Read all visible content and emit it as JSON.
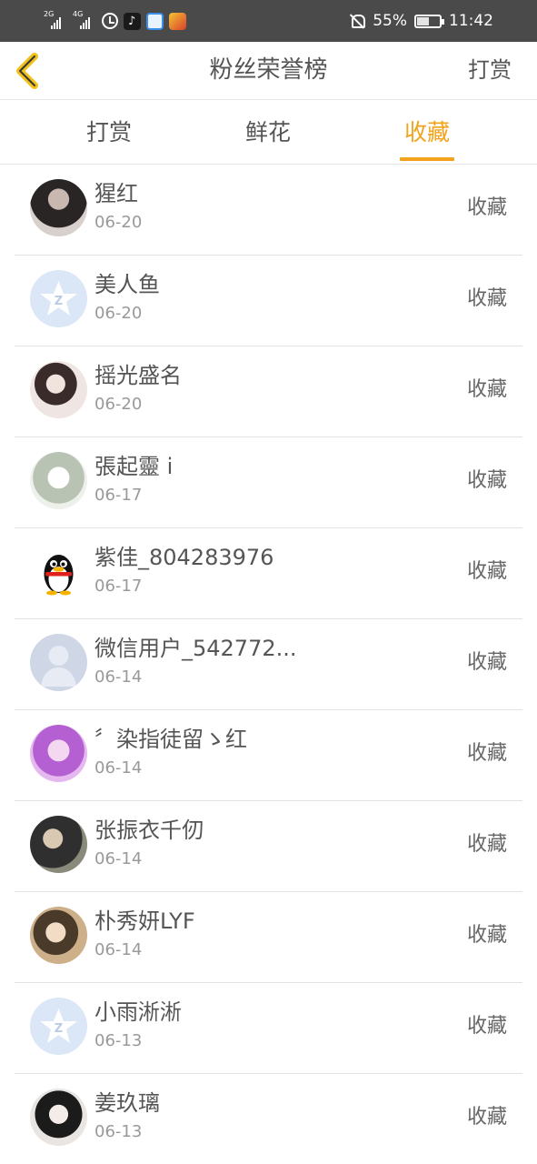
{
  "status_bar": {
    "network_1": "2G",
    "network_2": "4G",
    "battery_percent": "55%",
    "battery_level": 0.55,
    "time": "11:42",
    "icons": [
      "signal-icon",
      "signal-icon",
      "alarm-icon",
      "tiktok-app-icon",
      "browser-app-icon",
      "game-app-icon",
      "bell-off-icon",
      "battery-icon"
    ]
  },
  "header": {
    "back_icon": "chevron-left-icon",
    "title": "粉丝荣誉榜",
    "action_label": "打赏"
  },
  "tabs": [
    {
      "label": "打赏",
      "active": false
    },
    {
      "label": "鲜花",
      "active": false
    },
    {
      "label": "收藏",
      "active": true
    }
  ],
  "list": [
    {
      "name": "猩红",
      "date": "06-20",
      "action": "收藏",
      "avatar": "photo-avatar"
    },
    {
      "name": "美人鱼",
      "date": "06-20",
      "action": "收藏",
      "avatar": "qq-star-avatar"
    },
    {
      "name": "摇光盛名",
      "date": "06-20",
      "action": "收藏",
      "avatar": "photo-avatar"
    },
    {
      "name": "張起靈 i",
      "date": "06-17",
      "action": "收藏",
      "avatar": "sketch-avatar"
    },
    {
      "name": "紫佳_804283976",
      "date": "06-17",
      "action": "收藏",
      "avatar": "qq-penguin-avatar"
    },
    {
      "name": "微信用户_542772...",
      "date": "06-14",
      "action": "收藏",
      "avatar": "default-user-avatar"
    },
    {
      "name": "〞染指徒留ゝ红",
      "date": "06-14",
      "action": "收藏",
      "avatar": "anime-avatar"
    },
    {
      "name": "张振衣千仞",
      "date": "06-14",
      "action": "收藏",
      "avatar": "photo-avatar"
    },
    {
      "name": "朴秀妍LYF",
      "date": "06-14",
      "action": "收藏",
      "avatar": "photo-avatar"
    },
    {
      "name": "小雨淅淅",
      "date": "06-13",
      "action": "收藏",
      "avatar": "qq-star-avatar"
    },
    {
      "name": "姜玖璃",
      "date": "06-13",
      "action": "收藏",
      "avatar": "photo-avatar"
    }
  ],
  "colors": {
    "accent": "#f2a31b",
    "status_bar_bg": "#4a4a4a",
    "text": "#555555",
    "date_text": "#999999",
    "divider": "#e2e2e2"
  }
}
